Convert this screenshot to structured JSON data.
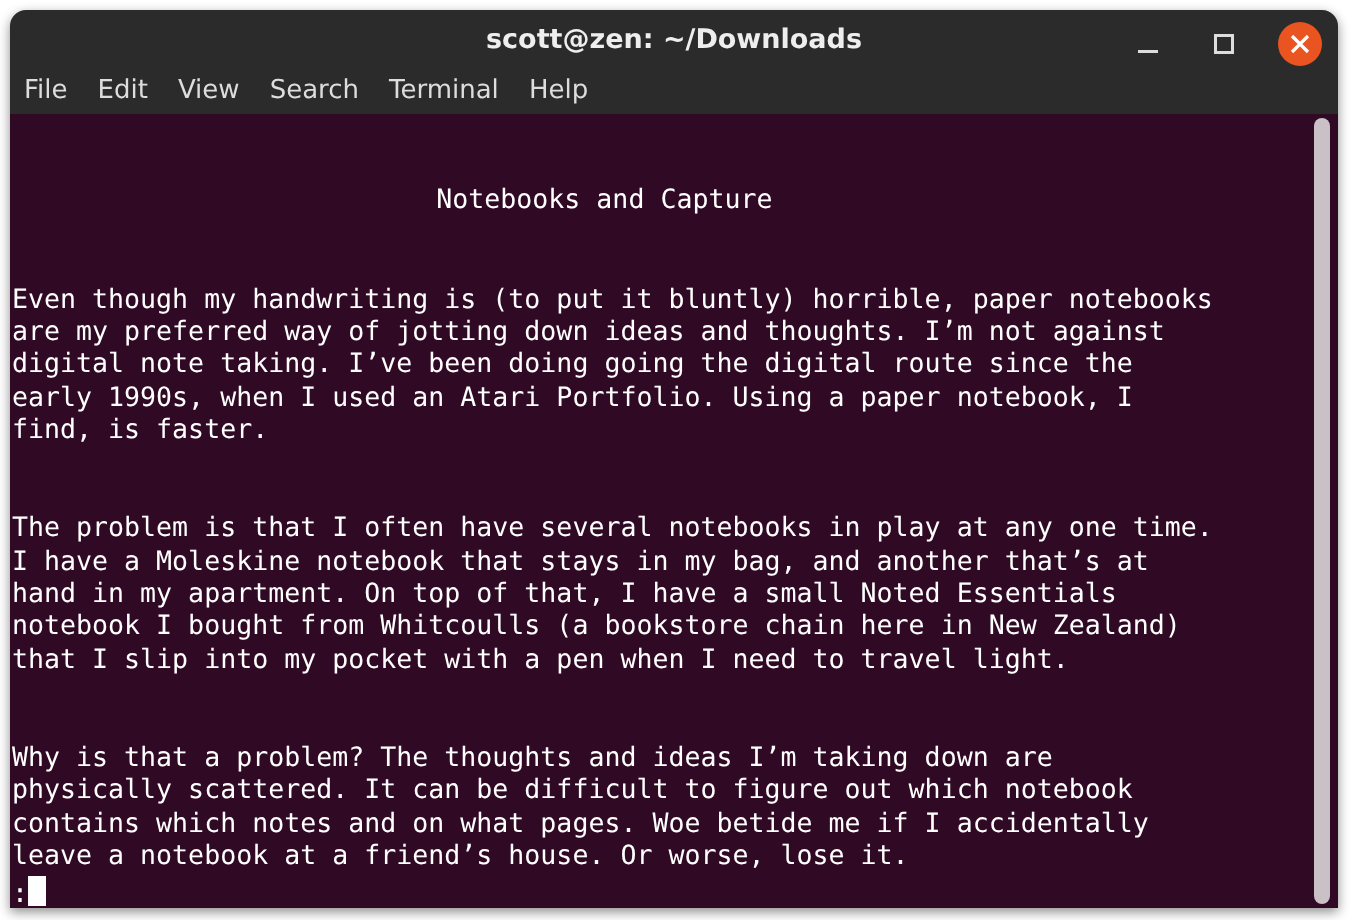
{
  "window": {
    "title": "scott@zen: ~/Downloads"
  },
  "menu": [
    "File",
    "Edit",
    "View",
    "Search",
    "Terminal",
    "Help"
  ],
  "terminal": {
    "heading": "Notebooks and Capture",
    "paragraphs": [
      [
        "Even though my handwriting is (to put it bluntly) horrible, paper notebooks",
        "are my preferred way of jotting down ideas and thoughts. I’m not against",
        "digital note taking. I’ve been doing going the digital route since the",
        "early 1990s, when I used an Atari Portfolio. Using a paper notebook, I",
        "find, is faster."
      ],
      [
        "The problem is that I often have several notebooks in play at any one time.",
        "I have a Moleskine notebook that stays in my bag, and another that’s at",
        "hand in my apartment. On top of that, I have a small Noted Essentials",
        "notebook I bought from Whitcoulls (a bookstore chain here in New Zealand)",
        "that I slip into my pocket with a pen when I need to travel light."
      ],
      [
        "Why is that a problem? The thoughts and ideas I’m taking down are",
        "physically scattered. It can be difficult to figure out which notebook",
        "contains which notes and on what pages. Woe betide me if I accidentally",
        "leave a notebook at a friend’s house. Or worse, lose it."
      ]
    ],
    "prompt": ":"
  }
}
